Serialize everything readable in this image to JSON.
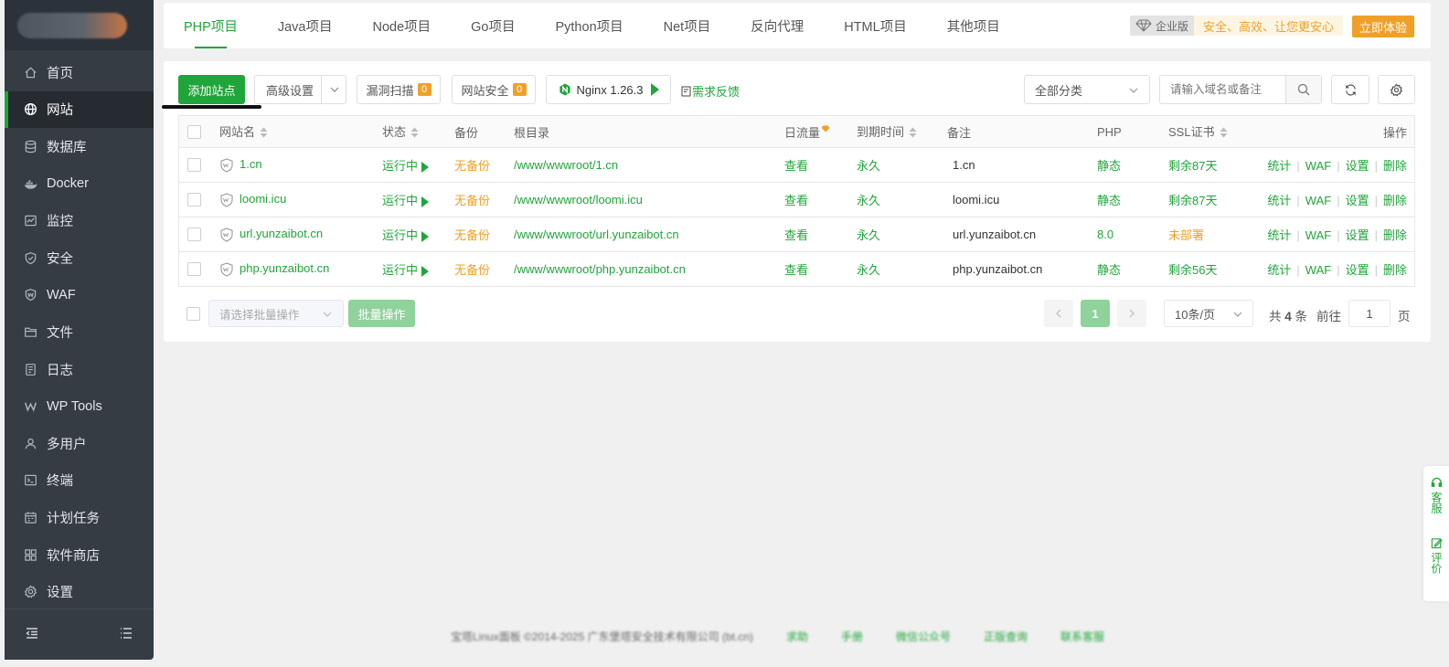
{
  "sidebar": {
    "items": [
      {
        "label": "首页",
        "icon": "home-icon"
      },
      {
        "label": "网站",
        "icon": "globe-icon",
        "active": true
      },
      {
        "label": "数据库",
        "icon": "database-icon"
      },
      {
        "label": "Docker",
        "icon": "docker-icon"
      },
      {
        "label": "监控",
        "icon": "monitor-icon"
      },
      {
        "label": "安全",
        "icon": "shield-icon"
      },
      {
        "label": "WAF",
        "icon": "waf-shield-icon"
      },
      {
        "label": "文件",
        "icon": "folder-icon"
      },
      {
        "label": "日志",
        "icon": "log-icon"
      },
      {
        "label": "WP Tools",
        "icon": "wordpress-icon"
      },
      {
        "label": "多用户",
        "icon": "users-icon"
      },
      {
        "label": "终端",
        "icon": "terminal-icon"
      },
      {
        "label": "计划任务",
        "icon": "calendar-icon"
      },
      {
        "label": "软件商店",
        "icon": "apps-icon"
      },
      {
        "label": "设置",
        "icon": "gear-icon"
      }
    ]
  },
  "tabs": [
    "PHP项目",
    "Java项目",
    "Node项目",
    "Go项目",
    "Python项目",
    "Net项目",
    "反向代理",
    "HTML项目",
    "其他项目"
  ],
  "promo": {
    "edition": "企业版",
    "slogan": "安全、高效、让您更安心",
    "trial": "立即体验"
  },
  "toolbar": {
    "add_site": "添加站点",
    "advanced": "高级设置",
    "vuln_scan": "漏洞扫描",
    "vuln_count": "0",
    "site_security": "网站安全",
    "security_count": "0",
    "nginx": "Nginx 1.26.3",
    "feedback": "需求反馈",
    "category": "全部分类",
    "search_placeholder": "请输入域名或备注"
  },
  "table": {
    "headers": {
      "name": "网站名",
      "status": "状态",
      "backup": "备份",
      "root": "根目录",
      "traffic": "日流量",
      "expire": "到期时间",
      "remark": "备注",
      "php": "PHP",
      "ssl": "SSL证书",
      "ops": "操作"
    },
    "rows": [
      {
        "name": "1.cn",
        "status": "运行中",
        "backup": "无备份",
        "root": "/www/wwwroot/1.cn",
        "traffic": "查看",
        "expire": "永久",
        "remark": "1.cn",
        "php": "静态",
        "ssl": "剩余87天"
      },
      {
        "name": "loomi.icu",
        "status": "运行中",
        "backup": "无备份",
        "root": "/www/wwwroot/loomi.icu",
        "traffic": "查看",
        "expire": "永久",
        "remark": "loomi.icu",
        "php": "静态",
        "ssl": "剩余87天"
      },
      {
        "name": "url.yunzaibot.cn",
        "status": "运行中",
        "backup": "无备份",
        "root": "/www/wwwroot/url.yunzaibot.cn",
        "traffic": "查看",
        "expire": "永久",
        "remark": "url.yunzaibot.cn",
        "php": "8.0",
        "ssl": "未部署"
      },
      {
        "name": "php.yunzaibot.cn",
        "status": "运行中",
        "backup": "无备份",
        "root": "/www/wwwroot/php.yunzaibot.cn",
        "traffic": "查看",
        "expire": "永久",
        "remark": "php.yunzaibot.cn",
        "php": "静态",
        "ssl": "剩余56天"
      }
    ],
    "ops": [
      "统计",
      "WAF",
      "设置",
      "删除"
    ]
  },
  "batch": {
    "placeholder": "请选择批量操作",
    "button": "批量操作"
  },
  "pagination": {
    "current": "1",
    "per_page": "10条/页",
    "total_prefix": "共",
    "total": "4",
    "total_suffix": "条",
    "goto": "前往",
    "page_value": "1",
    "page_suffix": "页"
  },
  "float": {
    "service": "客服",
    "review": "评价"
  },
  "footer": {
    "copyright": "宝塔Linux面板 ©2014-2025 广东堡塔安全技术有限公司 (bt.cn)",
    "links": [
      "求助",
      "手册",
      "微信公众号",
      "正版查询",
      "联系客服"
    ]
  }
}
